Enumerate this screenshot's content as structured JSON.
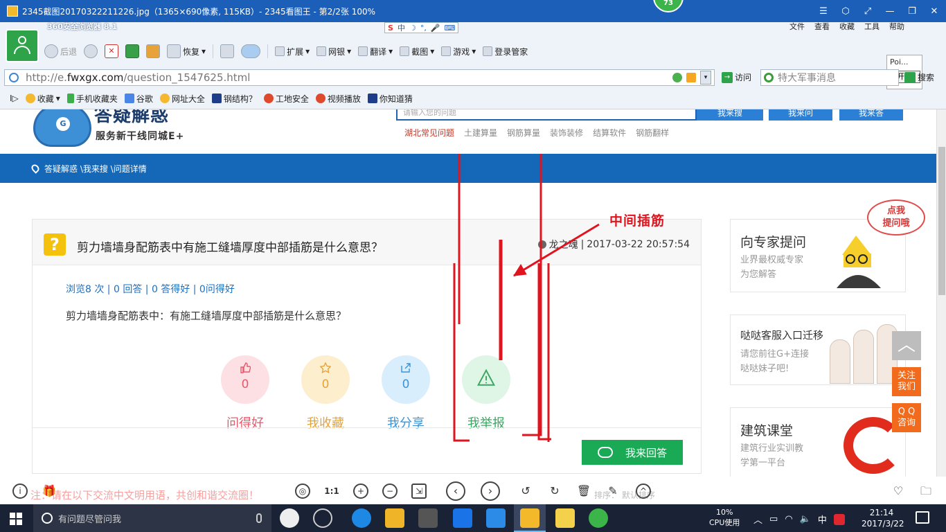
{
  "viewer": {
    "title": "2345截图20170322211226.jpg（1365×690像素, 115KB）- 2345看图王 - 第2/2张 100%",
    "badge": "73",
    "controls": [
      "☰",
      "⬡",
      "⤢",
      "—",
      "❐",
      "✕"
    ]
  },
  "browser": {
    "brand": "360安全浏览器 8.1",
    "sogou_items": [
      "S",
      "中",
      "☽",
      "°,",
      "🎤",
      "⌨"
    ],
    "menu": [
      "文件",
      "查看",
      "收藏",
      "工具",
      "帮助"
    ],
    "toolbar": {
      "back": "后退",
      "restore": "恢复",
      "extend": "扩展",
      "netbank": "网银",
      "translate": "翻译",
      "screenshot": "截图",
      "games": "游戏",
      "manager": "登录管家"
    },
    "popup": {
      "text": "Poi...",
      "start": "开始"
    },
    "url_prefix": "http://e.",
    "url_domain": "fwxgx.com",
    "url_path": "/question_1547625.html",
    "visit": "访问",
    "search_placeholder": "特大军事消息",
    "search": "搜索",
    "bookmarks": [
      "收藏",
      "手机收藏夹",
      "谷歌",
      "网址大全",
      "钢结构？",
      "工地安全",
      "视频播放",
      "你知道猜"
    ]
  },
  "site": {
    "logo_title": "答疑解惑",
    "logo_sub": "服务新干线同城E+",
    "search_hint": "请输入您的问题",
    "buttons": [
      "我来搜",
      "我来问",
      "我来答"
    ],
    "hot_links": [
      "湖北常见问题",
      "土建算量",
      "钢筋算量",
      "装饰装修",
      "结算软件",
      "钢筋翻样"
    ],
    "breadcrumb": "答疑解惑 \\我来搜 \\问题详情"
  },
  "question": {
    "title": "剪力墙墙身配筋表中有施工缝墙厚度中部插筋是什么意思？",
    "author": "龙之魂",
    "datetime": "2017-03-22 20:57:54",
    "stats": "浏览8 次 | 0 回答 | 0 答得好 | 0问得好",
    "body": "剪力墙墙身配筋表中：有施工缝墙厚度中部插筋是什么意思？",
    "actions": [
      {
        "label": "问得好",
        "count": "0",
        "bg": "#fde0e4",
        "fg": "#e45a6c"
      },
      {
        "label": "我收藏",
        "count": "0",
        "bg": "#fdeecd",
        "fg": "#e3a43a"
      },
      {
        "label": "我分享",
        "count": "0",
        "bg": "#d9eefc",
        "fg": "#3a93d4"
      },
      {
        "label": "我举报",
        "count": "",
        "bg": "#dff5e5",
        "fg": "#3aa761"
      }
    ],
    "answer_button": "我来回答"
  },
  "annotation": "中间插筋",
  "sidebar": {
    "expert": {
      "title": "向专家提问",
      "sub": [
        "业界最权威专家",
        "为您解答"
      ],
      "bubble": [
        "点我",
        "提问哦"
      ]
    },
    "service": {
      "title": "哒哒客服入口迁移",
      "sub": [
        "请您前往G+连接",
        "哒哒妹子吧!"
      ]
    },
    "course": {
      "title": "建筑课堂",
      "sub": [
        "建筑行业实训教",
        "学第一平台"
      ]
    },
    "float_follow": [
      "关注",
      "我们"
    ],
    "float_qq": [
      "Q Q",
      "咨询"
    ]
  },
  "viewer_bottom": {
    "notice": "注：请在以下交流中文明用语，共创和谐交流圈！",
    "sort": "排序：  默认排序"
  },
  "taskbar": {
    "search": "有问题尽管问我",
    "cpu_value": "10%",
    "cpu_label": "CPU使用",
    "ime": "中",
    "time": "21:14",
    "date": "2017/3/22"
  },
  "colors": {
    "viewer_title": "#1c5fb8",
    "crumb_bar": "#1567b8",
    "annotation_red": "#e0141e",
    "answer_green": "#1aaa55",
    "float_orange": "#f26a1b"
  }
}
